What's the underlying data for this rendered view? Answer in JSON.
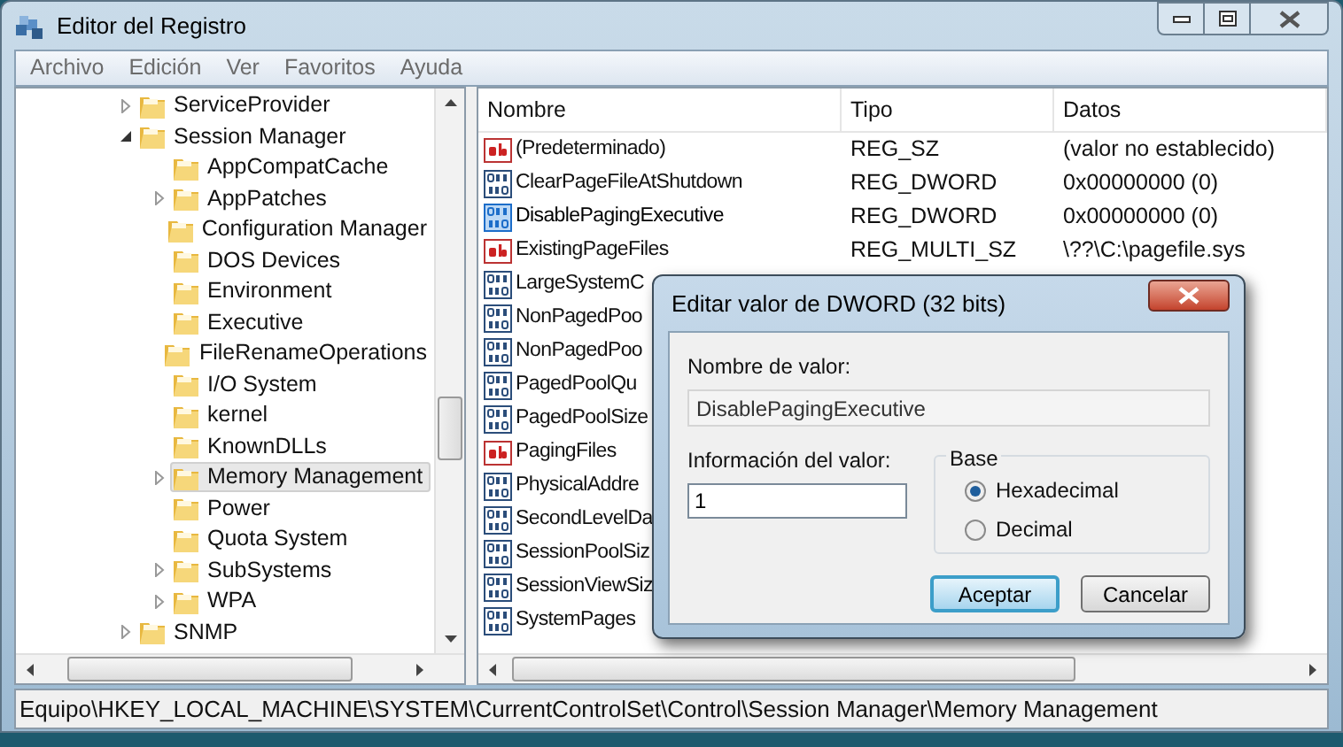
{
  "window": {
    "title": "Editor del Registro"
  },
  "menu": [
    "Archivo",
    "Edición",
    "Ver",
    "Favoritos",
    "Ayuda"
  ],
  "tree": [
    {
      "label": "ServiceProvider",
      "expanded": false,
      "selected": false
    },
    {
      "label": "Session Manager",
      "expanded": true,
      "selected": false,
      "children": [
        {
          "label": "AppCompatCache",
          "selected": false
        },
        {
          "label": "AppPatches",
          "expanded": false,
          "selected": false
        },
        {
          "label": "Configuration Manager",
          "selected": false
        },
        {
          "label": "DOS Devices",
          "selected": false
        },
        {
          "label": "Environment",
          "selected": false
        },
        {
          "label": "Executive",
          "selected": false
        },
        {
          "label": "FileRenameOperations",
          "selected": false
        },
        {
          "label": "I/O System",
          "selected": false
        },
        {
          "label": "kernel",
          "selected": false
        },
        {
          "label": "KnownDLLs",
          "selected": false
        },
        {
          "label": "Memory Management",
          "expanded": false,
          "selected": true
        },
        {
          "label": "Power",
          "selected": false
        },
        {
          "label": "Quota System",
          "selected": false
        },
        {
          "label": "SubSystems",
          "expanded": false,
          "selected": false
        },
        {
          "label": "WPA",
          "expanded": false,
          "selected": false
        }
      ]
    },
    {
      "label": "SNMP",
      "expanded": false,
      "selected": false
    }
  ],
  "values": {
    "columns": [
      "Nombre",
      "Tipo",
      "Datos"
    ],
    "rows": [
      {
        "kind": "string",
        "name": "(Predeterminado)",
        "type": "REG_SZ",
        "data": "(valor no establecido)",
        "selected": false
      },
      {
        "kind": "binary",
        "name": "ClearPageFileAtShutdown",
        "type": "REG_DWORD",
        "data": "0x00000000 (0)",
        "selected": false
      },
      {
        "kind": "binary",
        "name": "DisablePagingExecutive",
        "type": "REG_DWORD",
        "data": "0x00000000 (0)",
        "selected": true
      },
      {
        "kind": "string",
        "name": "ExistingPageFiles",
        "type": "REG_MULTI_SZ",
        "data": "\\??\\C:\\pagefile.sys",
        "selected": false
      },
      {
        "kind": "binary",
        "name": "LargeSystemC",
        "selected": false
      },
      {
        "kind": "binary",
        "name": "NonPagedPoo",
        "selected": false
      },
      {
        "kind": "binary",
        "name": "NonPagedPoo",
        "selected": false
      },
      {
        "kind": "binary",
        "name": "PagedPoolQu",
        "selected": false
      },
      {
        "kind": "binary",
        "name": "PagedPoolSize",
        "selected": false
      },
      {
        "kind": "string",
        "name": "PagingFiles",
        "selected": false
      },
      {
        "kind": "binary",
        "name": "PhysicalAddre",
        "selected": false
      },
      {
        "kind": "binary",
        "name": "SecondLevelDa",
        "selected": false
      },
      {
        "kind": "binary",
        "name": "SessionPoolSiz",
        "selected": false
      },
      {
        "kind": "binary",
        "name": "SessionViewSiz",
        "selected": false
      },
      {
        "kind": "binary",
        "name": "SystemPages",
        "selected": false
      }
    ]
  },
  "status_bar": "Equipo\\HKEY_LOCAL_MACHINE\\SYSTEM\\CurrentControlSet\\Control\\Session Manager\\Memory Management",
  "dialog": {
    "title": "Editar valor de DWORD (32 bits)",
    "name_label": "Nombre de valor:",
    "name_value": "DisablePagingExecutive",
    "data_label": "Información del valor:",
    "data_value": "1",
    "base_label": "Base",
    "base_options": [
      {
        "label": "Hexadecimal",
        "selected": true
      },
      {
        "label": "Decimal",
        "selected": false
      }
    ],
    "buttons": [
      {
        "label": "Aceptar",
        "default": true
      },
      {
        "label": "Cancelar",
        "default": false
      }
    ]
  }
}
